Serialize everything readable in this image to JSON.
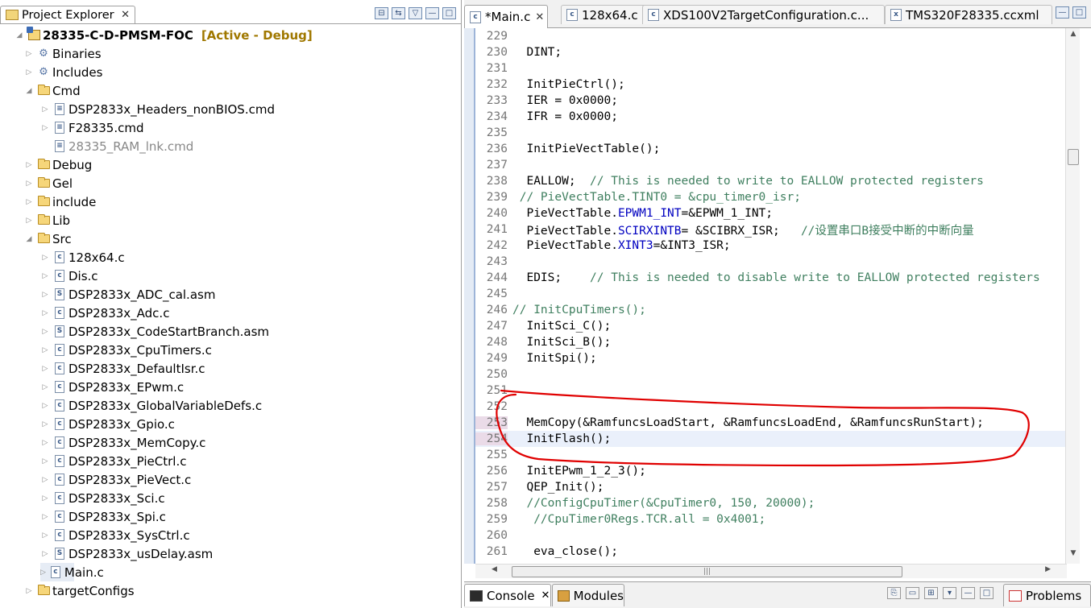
{
  "explorer": {
    "tab_label": "Project Explorer",
    "close": "✕",
    "tools": [
      "⊟",
      "⇆",
      "▽",
      "—",
      "□"
    ],
    "project": {
      "name": "28335-C-D-PMSM-FOC",
      "status": "[Active - Debug]"
    },
    "items": [
      {
        "label": "Binaries",
        "kind": "bin",
        "level": 1,
        "twisty": "▷"
      },
      {
        "label": "Includes",
        "kind": "bin",
        "level": 1,
        "twisty": "▷"
      },
      {
        "label": "Cmd",
        "kind": "folder",
        "level": 1,
        "twisty": "◢"
      },
      {
        "label": "DSP2833x_Headers_nonBIOS.cmd",
        "kind": "file",
        "level": 2,
        "twisty": "▷"
      },
      {
        "label": "F28335.cmd",
        "kind": "file",
        "level": 2,
        "twisty": "▷"
      },
      {
        "label": "28335_RAM_lnk.cmd",
        "kind": "file",
        "level": 2,
        "twisty": "",
        "grey": true
      },
      {
        "label": "Debug",
        "kind": "folder",
        "level": 1,
        "twisty": "▷"
      },
      {
        "label": "Gel",
        "kind": "folder",
        "level": 1,
        "twisty": "▷"
      },
      {
        "label": "include",
        "kind": "folder",
        "level": 1,
        "twisty": "▷"
      },
      {
        "label": "Lib",
        "kind": "folder",
        "level": 1,
        "twisty": "▷"
      },
      {
        "label": "Src",
        "kind": "folder",
        "level": 1,
        "twisty": "◢"
      },
      {
        "label": "128x64.c",
        "kind": "file",
        "level": 2,
        "twisty": "▷"
      },
      {
        "label": "Dis.c",
        "kind": "file",
        "level": 2,
        "twisty": "▷"
      },
      {
        "label": "DSP2833x_ADC_cal.asm",
        "kind": "file",
        "level": 2,
        "twisty": "▷"
      },
      {
        "label": "DSP2833x_Adc.c",
        "kind": "file",
        "level": 2,
        "twisty": "▷"
      },
      {
        "label": "DSP2833x_CodeStartBranch.asm",
        "kind": "file",
        "level": 2,
        "twisty": "▷"
      },
      {
        "label": "DSP2833x_CpuTimers.c",
        "kind": "file",
        "level": 2,
        "twisty": "▷"
      },
      {
        "label": "DSP2833x_DefaultIsr.c",
        "kind": "file",
        "level": 2,
        "twisty": "▷"
      },
      {
        "label": "DSP2833x_EPwm.c",
        "kind": "file",
        "level": 2,
        "twisty": "▷"
      },
      {
        "label": "DSP2833x_GlobalVariableDefs.c",
        "kind": "file",
        "level": 2,
        "twisty": "▷"
      },
      {
        "label": "DSP2833x_Gpio.c",
        "kind": "file",
        "level": 2,
        "twisty": "▷"
      },
      {
        "label": "DSP2833x_MemCopy.c",
        "kind": "file",
        "level": 2,
        "twisty": "▷"
      },
      {
        "label": "DSP2833x_PieCtrl.c",
        "kind": "file",
        "level": 2,
        "twisty": "▷"
      },
      {
        "label": "DSP2833x_PieVect.c",
        "kind": "file",
        "level": 2,
        "twisty": "▷"
      },
      {
        "label": "DSP2833x_Sci.c",
        "kind": "file",
        "level": 2,
        "twisty": "▷"
      },
      {
        "label": "DSP2833x_Spi.c",
        "kind": "file",
        "level": 2,
        "twisty": "▷"
      },
      {
        "label": "DSP2833x_SysCtrl.c",
        "kind": "file",
        "level": 2,
        "twisty": "▷"
      },
      {
        "label": "DSP2833x_usDelay.asm",
        "kind": "file",
        "level": 2,
        "twisty": "▷"
      },
      {
        "label": "Main.c",
        "kind": "file",
        "level": 2,
        "twisty": "▷",
        "selected": true
      },
      {
        "label": "targetConfigs",
        "kind": "folder",
        "level": 1,
        "twisty": "▷"
      }
    ]
  },
  "editor": {
    "tabs": [
      {
        "label": "*Main.c",
        "active": true,
        "close": "✕"
      },
      {
        "label": "128x64.c",
        "active": false
      },
      {
        "label": "XDS100V2TargetConfiguration.c...",
        "active": false
      },
      {
        "label": "TMS320F28335.ccxml",
        "active": false
      }
    ],
    "window_tools": [
      "—",
      "□"
    ],
    "lines": [
      {
        "n": "229",
        "parts": [
          {
            "t": ""
          }
        ]
      },
      {
        "n": "230",
        "parts": [
          {
            "t": "  DINT;"
          }
        ]
      },
      {
        "n": "231",
        "parts": [
          {
            "t": ""
          }
        ]
      },
      {
        "n": "232",
        "parts": [
          {
            "t": "  InitPieCtrl();"
          }
        ]
      },
      {
        "n": "233",
        "parts": [
          {
            "t": "  IER = 0x0000;"
          }
        ]
      },
      {
        "n": "234",
        "parts": [
          {
            "t": "  IFR = 0x0000;"
          }
        ]
      },
      {
        "n": "235",
        "parts": [
          {
            "t": ""
          }
        ]
      },
      {
        "n": "236",
        "parts": [
          {
            "t": "  InitPieVectTable();"
          }
        ]
      },
      {
        "n": "237",
        "parts": [
          {
            "t": ""
          }
        ]
      },
      {
        "n": "238",
        "parts": [
          {
            "t": "  EALLOW;  "
          },
          {
            "t": "// This is needed to write to EALLOW protected registers",
            "c": "cm"
          }
        ]
      },
      {
        "n": "239",
        "parts": [
          {
            "t": " // PieVectTable.TINT0 = &cpu_timer0_isr;",
            "c": "cm"
          }
        ]
      },
      {
        "n": "240",
        "parts": [
          {
            "t": "  PieVectTable."
          },
          {
            "t": "EPWM1_INT",
            "c": "fld"
          },
          {
            "t": "=&EPWM_1_INT;"
          }
        ]
      },
      {
        "n": "241",
        "parts": [
          {
            "t": "  PieVectTable."
          },
          {
            "t": "SCIRXINTB",
            "c": "fld"
          },
          {
            "t": "= &SCIBRX_ISR;   "
          },
          {
            "t": "//设置串口B接受中断的中断向量",
            "c": "cm"
          }
        ]
      },
      {
        "n": "242",
        "parts": [
          {
            "t": "  PieVectTable."
          },
          {
            "t": "XINT3",
            "c": "fld"
          },
          {
            "t": "=&INT3_ISR;"
          }
        ]
      },
      {
        "n": "243",
        "parts": [
          {
            "t": ""
          }
        ]
      },
      {
        "n": "244",
        "parts": [
          {
            "t": "  EDIS;    "
          },
          {
            "t": "// This is needed to disable write to EALLOW protected registers",
            "c": "cm"
          }
        ]
      },
      {
        "n": "245",
        "parts": [
          {
            "t": ""
          }
        ]
      },
      {
        "n": "246",
        "parts": [
          {
            "t": "// InitCpuTimers();",
            "c": "cm"
          }
        ]
      },
      {
        "n": "247",
        "parts": [
          {
            "t": "  InitSci_C();"
          }
        ]
      },
      {
        "n": "248",
        "parts": [
          {
            "t": "  InitSci_B();"
          }
        ]
      },
      {
        "n": "249",
        "parts": [
          {
            "t": "  InitSpi();"
          }
        ]
      },
      {
        "n": "250",
        "parts": [
          {
            "t": ""
          }
        ]
      },
      {
        "n": "251",
        "parts": [
          {
            "t": ""
          }
        ]
      },
      {
        "n": "252",
        "parts": [
          {
            "t": ""
          }
        ]
      },
      {
        "n": "253",
        "parts": [
          {
            "t": "  MemCopy(&RamfuncsLoadStart, &RamfuncsLoadEnd, &RamfuncsRunStart);"
          }
        ],
        "mark": true
      },
      {
        "n": "254",
        "parts": [
          {
            "t": "  InitFlash();"
          }
        ],
        "mark": true,
        "hl": true
      },
      {
        "n": "255",
        "parts": [
          {
            "t": ""
          }
        ]
      },
      {
        "n": "256",
        "parts": [
          {
            "t": "  InitEPwm_1_2_3();"
          }
        ]
      },
      {
        "n": "257",
        "parts": [
          {
            "t": "  QEP_Init();"
          }
        ]
      },
      {
        "n": "258",
        "parts": [
          {
            "t": "  //ConfigCpuTimer(&CpuTimer0, 150, 20000);",
            "c": "cm"
          }
        ]
      },
      {
        "n": "259",
        "parts": [
          {
            "t": "   //CpuTimer0Regs.TCR.all = 0x4001;",
            "c": "cm"
          }
        ]
      },
      {
        "n": "260",
        "parts": [
          {
            "t": ""
          }
        ]
      },
      {
        "n": "261",
        "parts": [
          {
            "t": "   eva_close();"
          }
        ]
      }
    ],
    "hscroll_grip": "|||"
  },
  "bottom": {
    "console_label": "Console",
    "console_close": "✕",
    "modules_label": "Modules",
    "problems_label": "Problems",
    "tools": [
      "⎘",
      "▭",
      "⊞",
      "▾",
      "—",
      "□"
    ]
  },
  "colors": {
    "annotation": "#e00000",
    "comment": "#3f7f5f",
    "field": "#0000c0"
  }
}
